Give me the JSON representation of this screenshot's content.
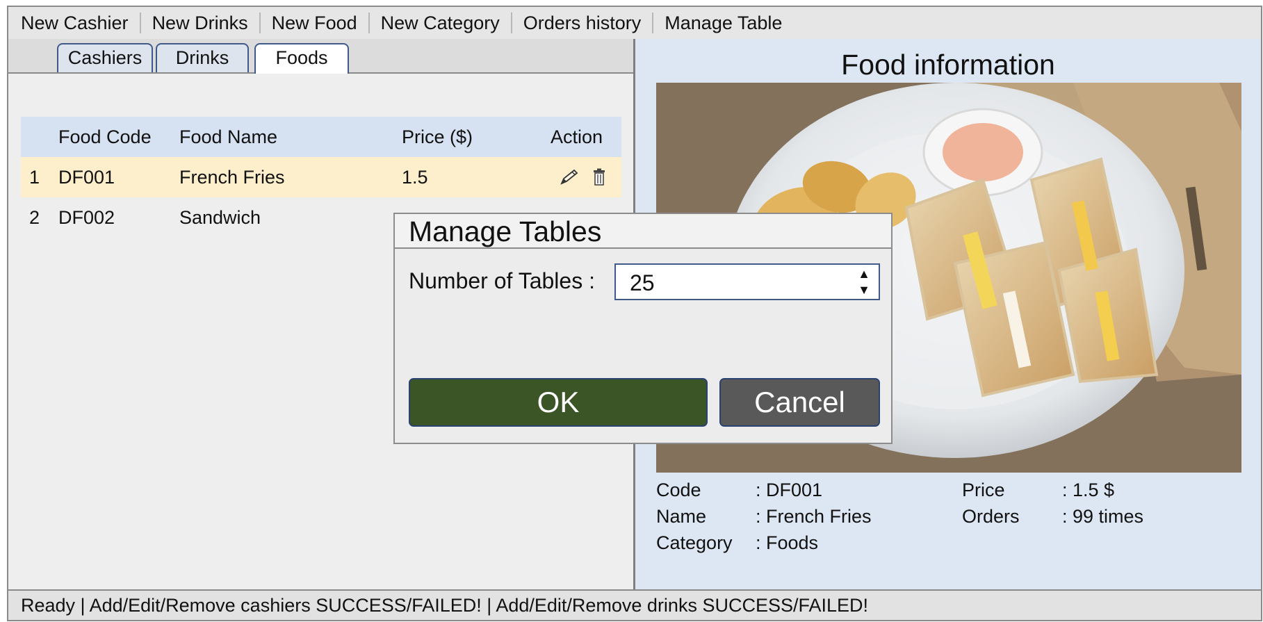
{
  "menu": [
    "New Cashier",
    "New Drinks",
    "New Food",
    "New Category",
    "Orders history",
    "Manage Table"
  ],
  "tabs": [
    {
      "label": "Cashiers",
      "active": false
    },
    {
      "label": "Drinks",
      "active": false
    },
    {
      "label": "Foods",
      "active": true
    }
  ],
  "table": {
    "headers": {
      "code": "Food Code",
      "name": "Food Name",
      "price": "Price ($)",
      "action": "Action"
    },
    "rows": [
      {
        "index": "1",
        "code": "DF001",
        "name": "French Fries",
        "price": "1.5",
        "selected": true
      },
      {
        "index": "2",
        "code": "DF002",
        "name": "Sandwich",
        "price": "",
        "selected": false
      }
    ],
    "action_icons": [
      "pencil-icon",
      "trash-icon"
    ]
  },
  "food_info": {
    "title": "Food information",
    "code_label": "Code",
    "code_value": ": DF001",
    "name_label": "Name",
    "name_value": ": French Fries",
    "category_label": "Category",
    "category_value": ": Foods",
    "price_label": "Price",
    "price_value": ": 1.5 $",
    "orders_label": "Orders",
    "orders_value": ": 99 times"
  },
  "dialog": {
    "title": "Manage Tables",
    "field_label": "Number of Tables :",
    "field_value": "25",
    "ok_label": "OK",
    "cancel_label": "Cancel"
  },
  "status": "Ready | Add/Edit/Remove cashiers SUCCESS/FAILED! | Add/Edit/Remove drinks SUCCESS/FAILED!",
  "colors": {
    "ok_button": "#3b5526",
    "cancel_button": "#595959",
    "selected_row": "#fdefcc",
    "header_row": "#d6e1f1",
    "right_panel": "#dde7f3"
  }
}
